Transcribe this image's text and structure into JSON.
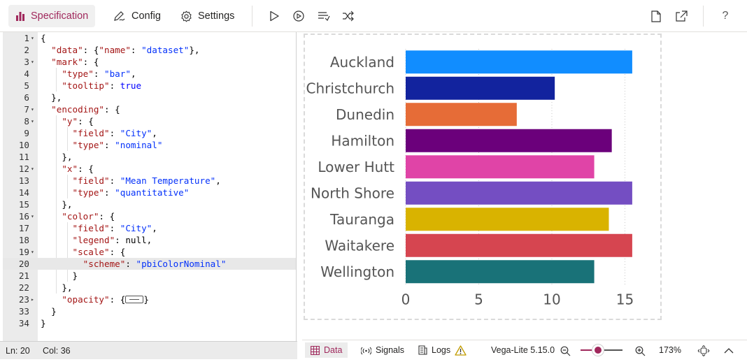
{
  "toolbar": {
    "tabs": [
      {
        "label": "Specification",
        "icon": "bar-chart-icon",
        "active": true
      },
      {
        "label": "Config",
        "icon": "pen-icon",
        "active": false
      },
      {
        "label": "Settings",
        "icon": "gear-icon",
        "active": false
      }
    ],
    "actions": [
      "run-icon",
      "auto-run-icon",
      "format-icon",
      "shuffle-icon"
    ],
    "right_actions": [
      "new-file-icon",
      "share-icon"
    ],
    "help_label": "?"
  },
  "editor": {
    "lines": [
      {
        "n": "1",
        "fold": "open",
        "html": "{"
      },
      {
        "n": "2",
        "fold": "",
        "html": "  <span class=\"k\">\"data\"</span>: {<span class=\"k\">\"name\"</span>: <span class=\"s\">\"dataset\"</span>},"
      },
      {
        "n": "3",
        "fold": "open",
        "html": "  <span class=\"k\">\"mark\"</span>: {"
      },
      {
        "n": "4",
        "fold": "",
        "html": "    <span class=\"k\">\"type\"</span>: <span class=\"s\">\"bar\"</span>,"
      },
      {
        "n": "5",
        "fold": "",
        "html": "    <span class=\"k\">\"tooltip\"</span>: <span class=\"b\">true</span>"
      },
      {
        "n": "6",
        "fold": "",
        "html": "  },"
      },
      {
        "n": "7",
        "fold": "open",
        "html": "  <span class=\"k\">\"encoding\"</span>: {"
      },
      {
        "n": "8",
        "fold": "open",
        "html": "    <span class=\"k\">\"y\"</span>: {"
      },
      {
        "n": "9",
        "fold": "",
        "html": "      <span class=\"k\">\"field\"</span>: <span class=\"s\">\"City\"</span>,"
      },
      {
        "n": "10",
        "fold": "",
        "html": "      <span class=\"k\">\"type\"</span>: <span class=\"s\">\"nominal\"</span>"
      },
      {
        "n": "11",
        "fold": "",
        "html": "    },"
      },
      {
        "n": "12",
        "fold": "open",
        "html": "    <span class=\"k\">\"x\"</span>: {"
      },
      {
        "n": "13",
        "fold": "",
        "html": "      <span class=\"k\">\"field\"</span>: <span class=\"s\">\"Mean Temperature\"</span>,"
      },
      {
        "n": "14",
        "fold": "",
        "html": "      <span class=\"k\">\"type\"</span>: <span class=\"s\">\"quantitative\"</span>"
      },
      {
        "n": "15",
        "fold": "",
        "html": "    },"
      },
      {
        "n": "16",
        "fold": "open",
        "html": "    <span class=\"k\">\"color\"</span>: {"
      },
      {
        "n": "17",
        "fold": "",
        "html": "      <span class=\"k\">\"field\"</span>: <span class=\"s\">\"City\"</span>,"
      },
      {
        "n": "18",
        "fold": "",
        "html": "      <span class=\"k\">\"legend\"</span>: null,"
      },
      {
        "n": "19",
        "fold": "open",
        "html": "      <span class=\"k\">\"scale\"</span>: {"
      },
      {
        "n": "20",
        "fold": "",
        "html": "        <span class=\"k\">\"scheme\"</span>: <span class=\"s\">\"pbiColorNominal\"</span>",
        "current": true
      },
      {
        "n": "21",
        "fold": "",
        "html": "      }"
      },
      {
        "n": "22",
        "fold": "",
        "html": "    },"
      },
      {
        "n": "23",
        "fold": "closed",
        "html": "    <span class=\"k\">\"opacity\"</span>: {<span class=\"collapsed-pill\"></span>}"
      },
      {
        "n": "33",
        "fold": "",
        "html": "  }"
      },
      {
        "n": "34",
        "fold": "",
        "html": "}"
      }
    ]
  },
  "status_left": {
    "line": "Ln: 20",
    "col": "Col: 36"
  },
  "chart_data": {
    "type": "bar",
    "orientation": "horizontal",
    "categories": [
      "Auckland",
      "Christchurch",
      "Dunedin",
      "Hamilton",
      "Lower Hutt",
      "North Shore",
      "Tauranga",
      "Waitakere",
      "Wellington"
    ],
    "values": [
      15.5,
      10.2,
      7.6,
      14.1,
      12.9,
      15.5,
      13.9,
      15.5,
      12.9
    ],
    "colors": [
      "#118dff",
      "#12239e",
      "#e66c37",
      "#6b007b",
      "#e044a7",
      "#744ec2",
      "#d9b300",
      "#d64550",
      "#197278"
    ],
    "x_ticks": [
      "0",
      "5",
      "10",
      "15"
    ],
    "xlim": [
      0,
      15.6
    ],
    "grid": true
  },
  "status_right": {
    "tabs": [
      {
        "label": "Data",
        "icon": "table-icon",
        "active": true
      },
      {
        "label": "Signals",
        "icon": "signal-icon",
        "active": false
      },
      {
        "label": "Logs",
        "icon": "logs-icon",
        "active": false
      }
    ],
    "version": "Vega-Lite 5.15.0",
    "zoom": "173%",
    "zoom_fraction": 0.42,
    "accent": "#a0285c",
    "warning_color": "#c19c00"
  }
}
